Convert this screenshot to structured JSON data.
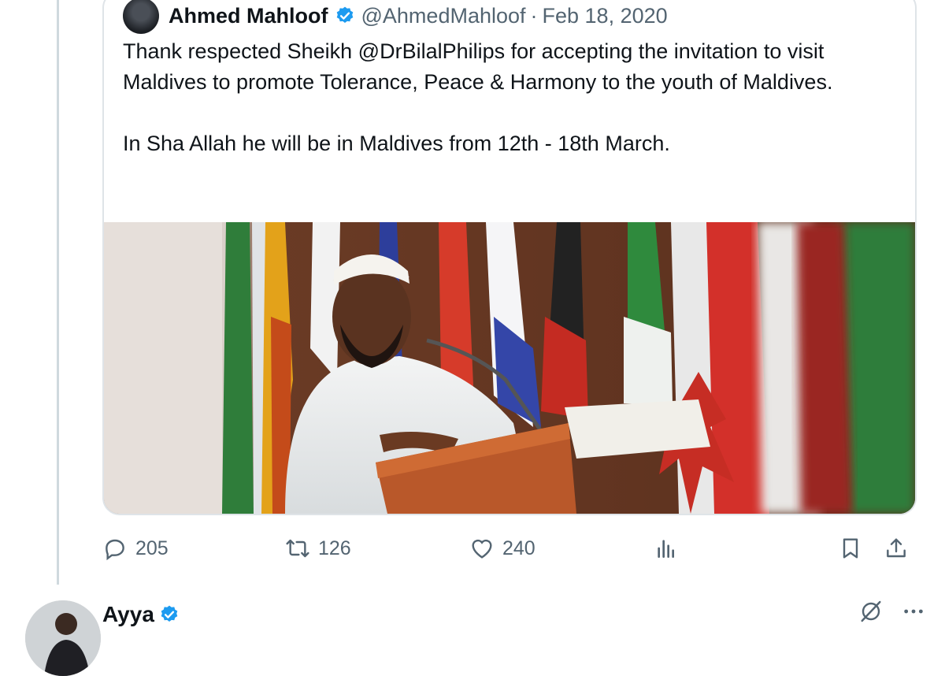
{
  "quoted_tweet": {
    "author_name": "Ahmed Mahloof",
    "handle": "@AhmedMahloof",
    "separator": "·",
    "date": "Feb 18, 2020",
    "text_paragraph_1": "Thank respected Sheikh @DrBilalPhilips for accepting the invitation to visit Maldives to promote Tolerance, Peace & Harmony to the youth of Maldives.",
    "text_paragraph_2": "In Sha Allah he will be in Maldives from 12th - 18th March.",
    "verified_color": "#1d9bf0"
  },
  "actions": {
    "reply_count": "205",
    "retweet_count": "126",
    "like_count": "240",
    "icons": [
      "reply-icon",
      "retweet-icon",
      "like-icon",
      "views-icon",
      "bookmark-icon",
      "share-icon"
    ]
  },
  "reply": {
    "author_name": "Ayya",
    "verified_color": "#1d9bf0",
    "icons": [
      "grok-icon",
      "more-icon"
    ]
  }
}
